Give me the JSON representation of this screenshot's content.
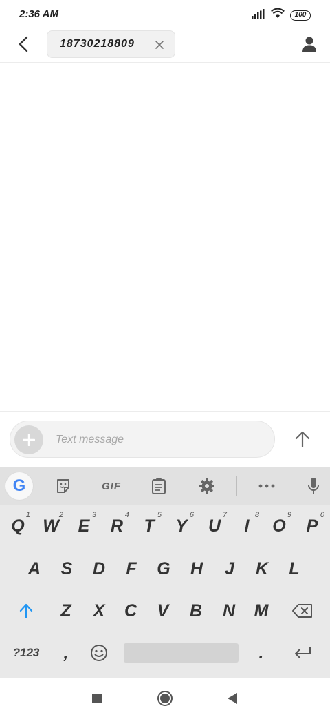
{
  "status_bar": {
    "time": "2:36 AM",
    "battery": "100"
  },
  "header": {
    "recipient": "18730218809"
  },
  "compose": {
    "placeholder": "Text message"
  },
  "keyboard": {
    "toolbar": {
      "gif_label": "GIF",
      "google_label": "G"
    },
    "row1": [
      {
        "label": "Q",
        "hint": "1"
      },
      {
        "label": "W",
        "hint": "2"
      },
      {
        "label": "E",
        "hint": "3"
      },
      {
        "label": "R",
        "hint": "4"
      },
      {
        "label": "T",
        "hint": "5"
      },
      {
        "label": "Y",
        "hint": "6"
      },
      {
        "label": "U",
        "hint": "7"
      },
      {
        "label": "I",
        "hint": "8"
      },
      {
        "label": "O",
        "hint": "9"
      },
      {
        "label": "P",
        "hint": "0"
      }
    ],
    "row2": [
      "A",
      "S",
      "D",
      "F",
      "G",
      "H",
      "J",
      "K",
      "L"
    ],
    "row3": [
      "Z",
      "X",
      "C",
      "V",
      "B",
      "N",
      "M"
    ],
    "row4": {
      "symbols": "?123",
      "comma": ",",
      "period": "."
    }
  },
  "colors": {
    "accent": "#2196F3",
    "google_blue": "#4285F4",
    "keyboard_bg": "#e9e9e9"
  }
}
